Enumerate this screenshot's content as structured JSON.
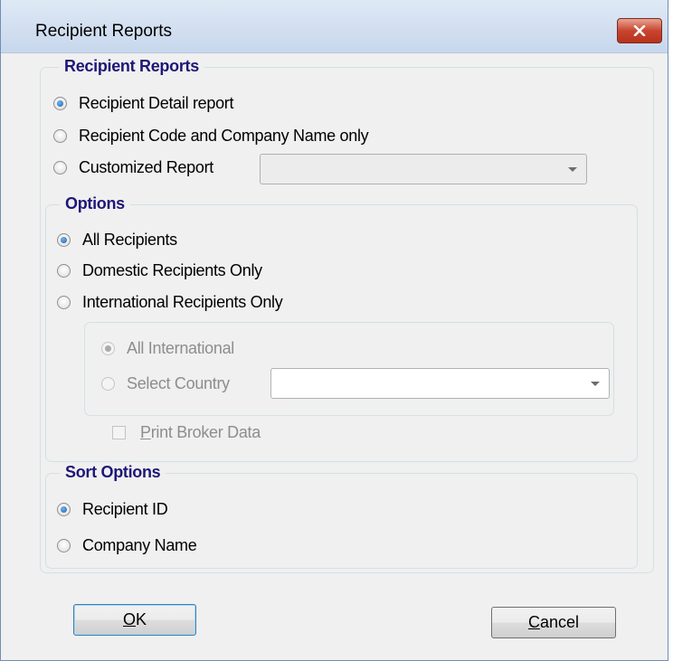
{
  "window": {
    "title": "Recipient Reports"
  },
  "recipient_reports": {
    "legend": "Recipient Reports",
    "options": [
      {
        "label": "Recipient Detail report",
        "checked": true
      },
      {
        "label": "Recipient Code and Company  Name only",
        "checked": false
      },
      {
        "label": "Customized Report",
        "checked": false
      }
    ],
    "custom_report_value": ""
  },
  "options": {
    "legend": "Options",
    "items": [
      {
        "label": "All Recipients",
        "checked": true
      },
      {
        "label": "Domestic Recipients Only",
        "checked": false
      },
      {
        "label": "International Recipients Only",
        "checked": false
      }
    ],
    "international": {
      "all_label": "All International",
      "select_label": "Select Country",
      "country_value": ""
    },
    "print_broker": {
      "mnemonic": "P",
      "rest": "rint Broker Data",
      "checked": false
    }
  },
  "sort_options": {
    "legend": "Sort Options",
    "items": [
      {
        "label": "Recipient ID",
        "checked": true
      },
      {
        "label": "Company Name",
        "checked": false
      }
    ]
  },
  "buttons": {
    "ok": {
      "mnemonic": "O",
      "rest": "K"
    },
    "cancel": {
      "mnemonic": "C",
      "rest": "ancel"
    }
  },
  "colors": {
    "group_title": "#1f1777",
    "radio_selected": "#1f5fa8",
    "close_button": "#c9452e"
  }
}
